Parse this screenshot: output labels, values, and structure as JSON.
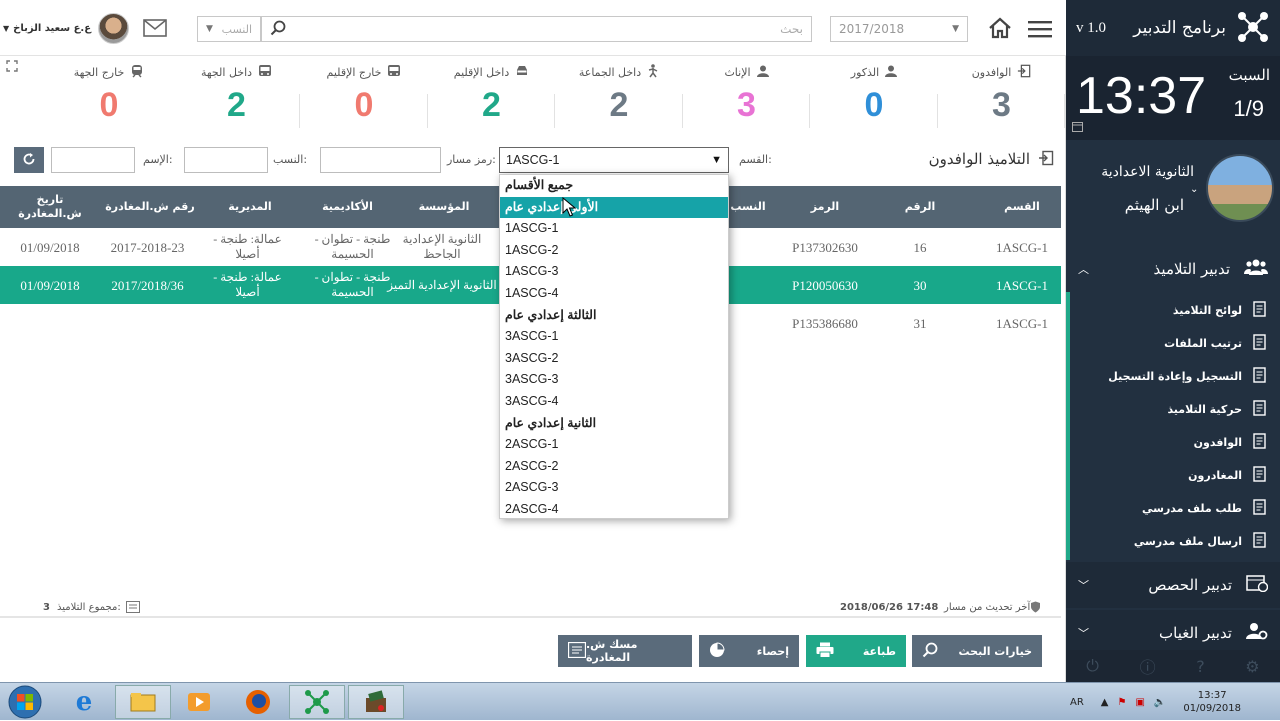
{
  "app": {
    "title": "برنامج التدبير",
    "version": "v 1.0",
    "day": "السبت",
    "time": "13:37",
    "date_short": "1/9",
    "school_line1": "الثانوية الاعدادية",
    "school_line2": "ابن الهيثم"
  },
  "topbar": {
    "year_value": "2017/2018",
    "search_placeholder": "بحث",
    "field_placeholder": "النسب",
    "user_name": "ع.ع سعيد الزباخ"
  },
  "stats": [
    {
      "label": "الوافدون",
      "value": "3",
      "color": "#6d7a85",
      "icon": "login-icon"
    },
    {
      "label": "الذكور",
      "value": "0",
      "color": "#2f8fd8",
      "icon": "user-icon"
    },
    {
      "label": "الإناث",
      "value": "3",
      "color": "#e873d4",
      "icon": "user-icon"
    },
    {
      "label": "داخل الجماعة",
      "value": "2",
      "color": "#6d7a85",
      "icon": "walk-icon"
    },
    {
      "label": "داخل الإقليم",
      "value": "2",
      "color": "#20a889",
      "icon": "car-icon"
    },
    {
      "label": "خارج الإقليم",
      "value": "0",
      "color": "#f07a6f",
      "icon": "bus-icon"
    },
    {
      "label": "داخل الجهة",
      "value": "2",
      "color": "#20a889",
      "icon": "bus-icon"
    },
    {
      "label": "خارج الجهة",
      "value": "0",
      "color": "#f07a6f",
      "icon": "train-icon"
    }
  ],
  "filters": {
    "section_title": "التلاميذ الوافدون",
    "class_label": "القسم:",
    "class_value": "1ASCG-1",
    "massar_label": "رمز مسار:",
    "lastname_label": "النسب:",
    "firstname_label": "الإسم:"
  },
  "table": {
    "headers": [
      "القسم",
      "الرقم",
      "الرمز",
      "النسب",
      "المؤسسة",
      "الأكاديمية",
      "المديرية",
      "رقم ش.المغادرة",
      "تاريخ ش.المغادرة"
    ],
    "rows": [
      {
        "class": "1ASCG-1",
        "num": "16",
        "code": "P137302630",
        "school": "الثانوية الإعدادية الجاحظ",
        "academy": "طنجة - تطوان - الحسيمة",
        "directorate": "عمالة: طنجة - أصيلا",
        "cert_no": "2017-2018-23",
        "cert_date": "01/09/2018"
      },
      {
        "class": "1ASCG-1",
        "num": "30",
        "code": "P120050630",
        "school": "الثانوية الإعدادية التميز",
        "academy": "طنجة - تطوان - الحسيمة",
        "directorate": "عمالة: طنجة - أصيلا",
        "cert_no": "2017/2018/36",
        "cert_date": "01/09/2018"
      },
      {
        "class": "1ASCG-1",
        "num": "31",
        "code": "P135386680",
        "school": "",
        "academy": "",
        "directorate": "",
        "cert_no": "",
        "cert_date": ""
      }
    ]
  },
  "dropdown": {
    "items": [
      {
        "text": "جميع الأقسام",
        "type": "grp"
      },
      {
        "text": "الأولى إعدادي عام",
        "type": "hl"
      },
      {
        "text": "1ASCG-1",
        "type": ""
      },
      {
        "text": "1ASCG-2",
        "type": ""
      },
      {
        "text": "1ASCG-3",
        "type": ""
      },
      {
        "text": "1ASCG-4",
        "type": ""
      },
      {
        "text": "الثالثة إعدادي عام",
        "type": "grp"
      },
      {
        "text": "3ASCG-1",
        "type": ""
      },
      {
        "text": "3ASCG-2",
        "type": ""
      },
      {
        "text": "3ASCG-3",
        "type": ""
      },
      {
        "text": "3ASCG-4",
        "type": ""
      },
      {
        "text": "الثانية إعدادي عام",
        "type": "grp"
      },
      {
        "text": "2ASCG-1",
        "type": ""
      },
      {
        "text": "2ASCG-2",
        "type": ""
      },
      {
        "text": "2ASCG-3",
        "type": ""
      },
      {
        "text": "2ASCG-4",
        "type": ""
      }
    ]
  },
  "status": {
    "last_update_label": "آخر تحديث من مسار",
    "last_update_value": "2018/06/26 17:48",
    "total_label": "مجموع التلاميذ:",
    "total_value": "3"
  },
  "buttons": {
    "search_options": "خيارات البحث",
    "print": "طباعة",
    "stats": "إحصاء",
    "cert": "مسك ش. المغادرة"
  },
  "sidebar": {
    "students_header": "تدبير التلاميذ",
    "items": [
      "لوائح التلاميذ",
      "ترتيب الملفات",
      "التسجيل وإعادة التسجيل",
      "حركية التلاميذ",
      "الوافدون",
      "المغادرون",
      "طلب ملف مدرسي",
      "ارسال ملف مدرسي"
    ],
    "sessions_header": "تدبير الحصص",
    "absence_header": "تدبير الغياب"
  },
  "taskbar": {
    "lang": "AR",
    "time": "13:37",
    "date": "01/09/2018"
  }
}
